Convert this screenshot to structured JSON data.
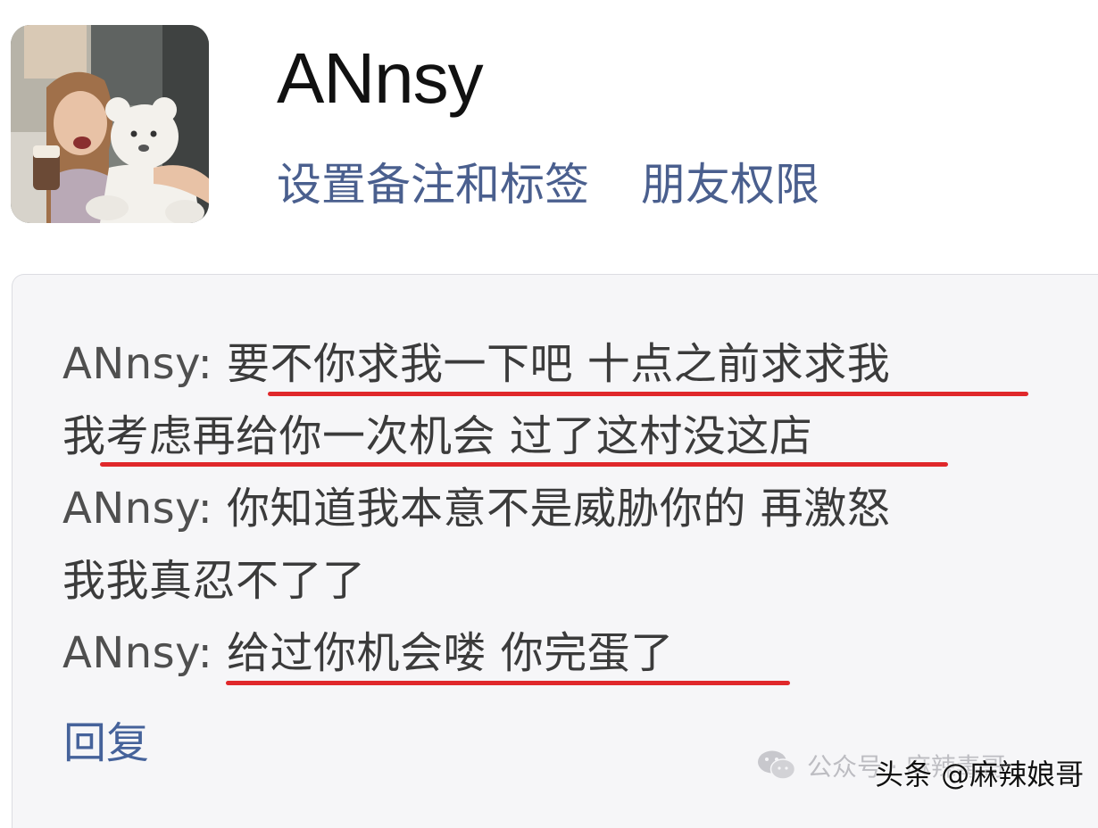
{
  "profile": {
    "nickname": "ANnsy",
    "actions": {
      "remark": "设置备注和标签",
      "permissions": "朋友权限"
    }
  },
  "comment": {
    "lines": [
      {
        "author": "ANnsy: ",
        "text": "要不你求我一下吧 十点之前求求我"
      },
      {
        "author": "",
        "text": "我考虑再给你一次机会 过了这村没这店"
      },
      {
        "author": "ANnsy: ",
        "text": "你知道我本意不是威胁你的 再激怒"
      },
      {
        "author": "",
        "text": "我我真忍不了了"
      },
      {
        "author": "ANnsy: ",
        "text": "给过你机会喽 你完蛋了"
      }
    ],
    "reply_label": "回复"
  },
  "watermarks": {
    "wechat": "公众号 · 麻辣毒哥",
    "toutiao": "头条 @麻辣娘哥"
  },
  "colors": {
    "link": "#4a5f8e",
    "underline": "#e0282b",
    "card_background": "#f6f6f8"
  },
  "icons": {
    "wechat": "wechat-logo-icon"
  }
}
